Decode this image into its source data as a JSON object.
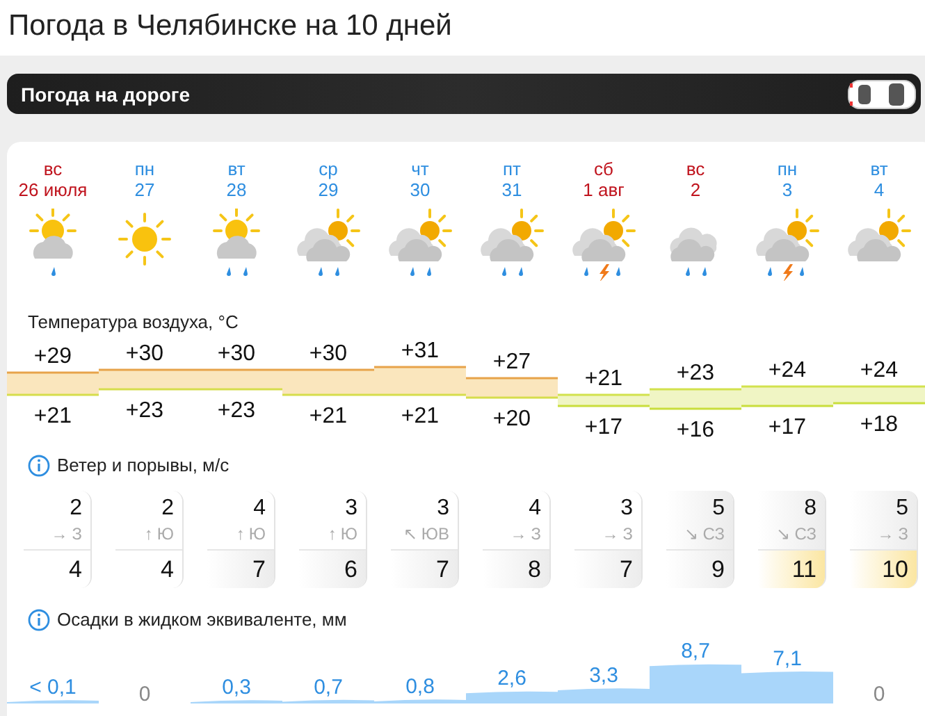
{
  "title": "Погода в Челябинске на 10 дней",
  "road_banner": {
    "label": "Погода на дороге"
  },
  "days": [
    {
      "dow": "вс",
      "date": "26 июля",
      "weekend": true,
      "kind": "suncloudlight",
      "thunder": false,
      "t_max": "+29",
      "t_min": "+21",
      "wind": {
        "speed": "2",
        "arrow": "→",
        "direction": "З",
        "color": "#ffffff",
        "gust": {
          "text": "4",
          "color": "#ffffff"
        }
      },
      "precip": "< 0,1"
    },
    {
      "dow": "пн",
      "date": "27",
      "weekend": false,
      "kind": "sun",
      "thunder": false,
      "t_max": "+30",
      "t_min": "+23",
      "wind": {
        "speed": "2",
        "arrow": "↑",
        "direction": "Ю",
        "color": "#ffffff",
        "gust": {
          "text": "4",
          "color": "#ffffff"
        }
      },
      "precip": "0"
    },
    {
      "dow": "вт",
      "date": "28",
      "weekend": false,
      "kind": "suncloudrain",
      "thunder": false,
      "t_max": "+30",
      "t_min": "+23",
      "wind": {
        "speed": "4",
        "arrow": "↑",
        "direction": "Ю",
        "color": "#ffffff",
        "gust": {
          "text": "7",
          "color": "#ececec"
        }
      },
      "precip": "0,3"
    },
    {
      "dow": "ср",
      "date": "29",
      "weekend": false,
      "kind": "cloudsunrain",
      "thunder": false,
      "t_max": "+30",
      "t_min": "+21",
      "wind": {
        "speed": "3",
        "arrow": "↑",
        "direction": "Ю",
        "color": "#ffffff",
        "gust": {
          "text": "6",
          "color": "#ececec"
        }
      },
      "precip": "0,7"
    },
    {
      "dow": "чт",
      "date": "30",
      "weekend": false,
      "kind": "cloudsunrain",
      "thunder": false,
      "t_max": "+31",
      "t_min": "+21",
      "wind": {
        "speed": "3",
        "arrow": "↖",
        "direction": "ЮВ",
        "color": "#ffffff",
        "gust": {
          "text": "7",
          "color": "#ececec"
        }
      },
      "precip": "0,8"
    },
    {
      "dow": "пт",
      "date": "31",
      "weekend": false,
      "kind": "cloudsunrain",
      "thunder": false,
      "t_max": "+27",
      "t_min": "+20",
      "wind": {
        "speed": "4",
        "arrow": "→",
        "direction": "З",
        "color": "#ffffff",
        "gust": {
          "text": "8",
          "color": "#ececec"
        }
      },
      "precip": "2,6"
    },
    {
      "dow": "сб",
      "date": "1 авг",
      "weekend": true,
      "kind": "cloudsunrain",
      "thunder": true,
      "t_max": "+21",
      "t_min": "+17",
      "wind": {
        "speed": "3",
        "arrow": "→",
        "direction": "З",
        "color": "#ffffff",
        "gust": {
          "text": "7",
          "color": "#ececec"
        }
      },
      "precip": "3,3"
    },
    {
      "dow": "вс",
      "date": "2",
      "weekend": true,
      "kind": "cloudsrain",
      "thunder": false,
      "t_max": "+23",
      "t_min": "+16",
      "wind": {
        "speed": "5",
        "arrow": "↘",
        "direction": "СЗ",
        "color": "#ececec",
        "gust": {
          "text": "9",
          "color": "#ececec"
        }
      },
      "precip": "8,7"
    },
    {
      "dow": "пн",
      "date": "3",
      "weekend": false,
      "kind": "cloudsunrain",
      "thunder": true,
      "t_max": "+24",
      "t_min": "+17",
      "wind": {
        "speed": "8",
        "arrow": "↘",
        "direction": "СЗ",
        "color": "#ececec",
        "gust": {
          "text": "11",
          "color": "#fbe6a2"
        }
      },
      "precip": "7,1"
    },
    {
      "dow": "вт",
      "date": "4",
      "weekend": false,
      "kind": "cloudsun",
      "thunder": false,
      "t_max": "+24",
      "t_min": "+18",
      "wind": {
        "speed": "5",
        "arrow": "→",
        "direction": "З",
        "color": "#ececec",
        "gust": {
          "text": "10",
          "color": "#fbe6a2"
        }
      },
      "precip": "0"
    }
  ],
  "temperature_header": "Температура воздуха, °C",
  "wind_header": "Ветер и порывы, м/с",
  "precip_header": "Осадки в жидком эквиваленте, мм"
}
